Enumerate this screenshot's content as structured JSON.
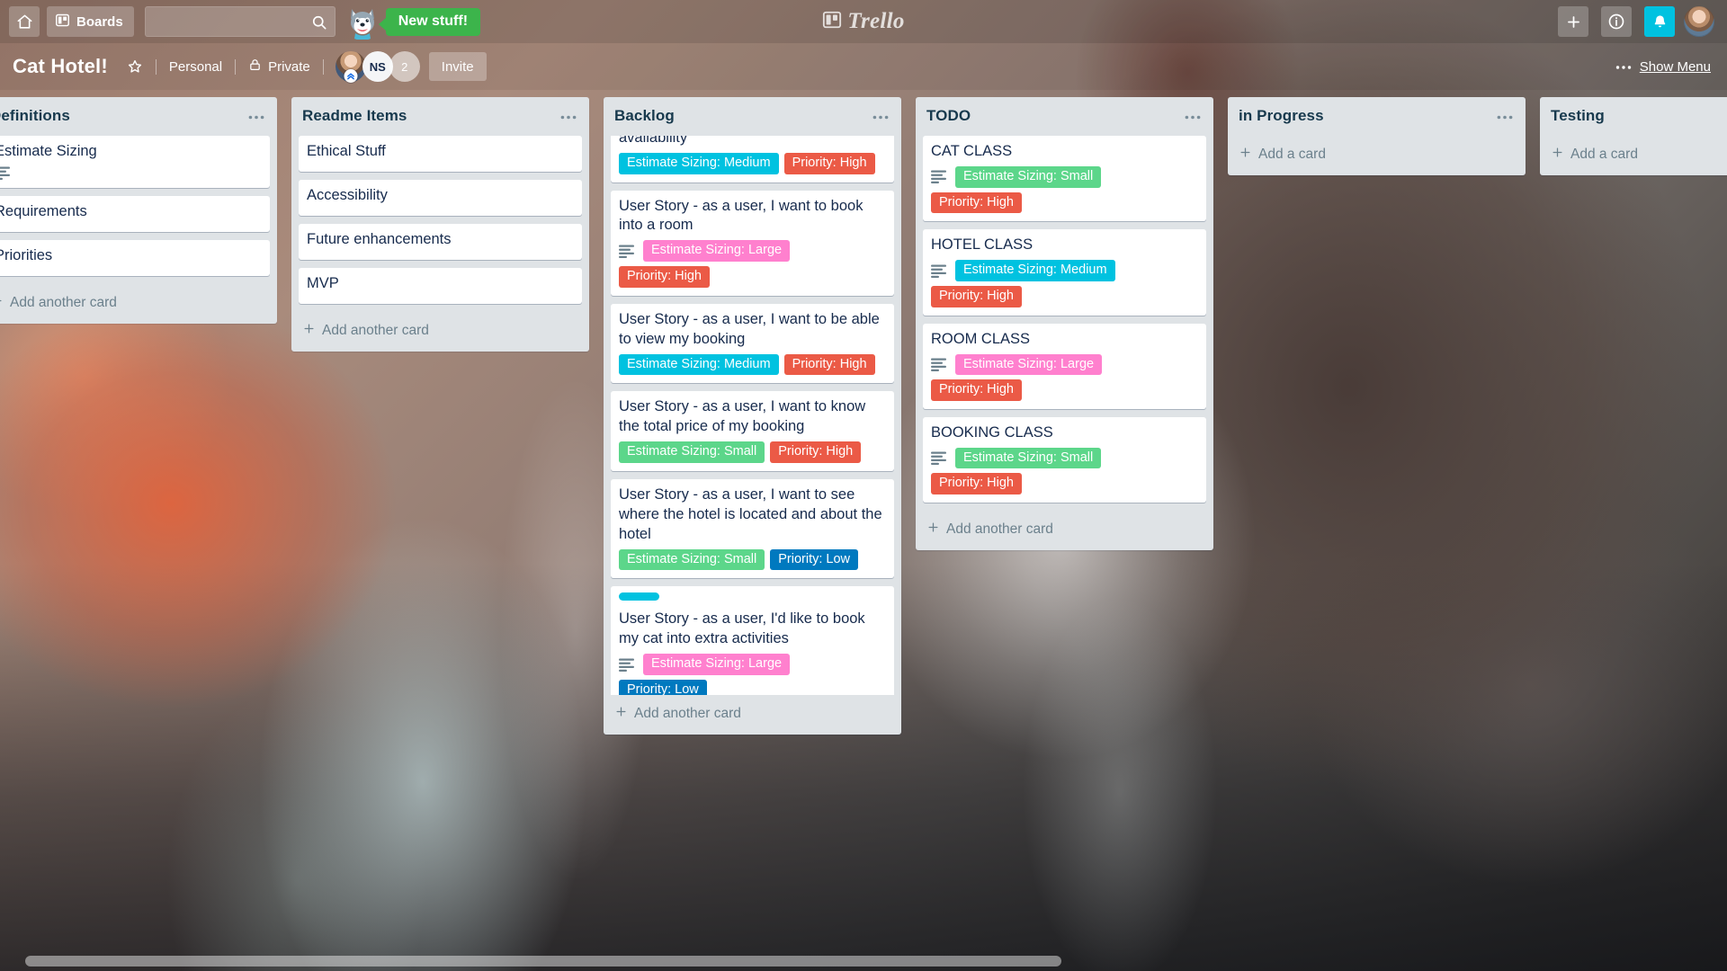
{
  "topnav": {
    "home_icon": "home-icon",
    "boards_label": "Boards",
    "boards_icon": "board-icon",
    "search_placeholder": "",
    "search_value": "",
    "search_icon": "search-icon",
    "mascot_icon": "husky-mascot-icon",
    "new_stuff_label": "New stuff!",
    "logo_text": "Trello",
    "logo_icon": "trello-logo-icon",
    "add_icon": "plus-icon",
    "info_icon": "info-icon",
    "notifications_icon": "bell-icon",
    "notifications_active_color": "#00c2e0",
    "avatar_icon": "user-avatar"
  },
  "boardbar": {
    "title": "Cat Hotel!",
    "star_icon": "star-icon",
    "team_label": "Personal",
    "visibility_label": "Private",
    "visibility_icon": "lock-icon",
    "members": [
      {
        "type": "photo",
        "label": "",
        "name": "member-avatar-photo"
      },
      {
        "type": "initials",
        "label": "NS",
        "name": "member-avatar-ns"
      },
      {
        "type": "count",
        "label": "2",
        "name": "member-overflow-count"
      }
    ],
    "invite_label": "Invite",
    "menu_dots": "•••",
    "show_menu_label": "Show Menu"
  },
  "colors": {
    "label_green": "#61bd4f",
    "label_green_light": "#5cd68a",
    "label_sky": "#00c2e0",
    "label_pink": "#ff80ce",
    "label_red": "#eb5a46",
    "label_blue": "#0079bf",
    "list_bg": "#dfe3e6",
    "card_bg": "#ffffff",
    "text_dark": "#172b4d"
  },
  "lists": [
    {
      "title": "Definitions",
      "clipped_left": true,
      "add_label": "Add another card",
      "cards": [
        {
          "title": "Estimate Sizing",
          "has_description": true,
          "labels": []
        },
        {
          "title": "Requirements",
          "has_description": false,
          "labels": []
        },
        {
          "title": "Priorities",
          "has_description": false,
          "labels": []
        }
      ]
    },
    {
      "title": "Readme Items",
      "add_label": "Add another card",
      "cards": [
        {
          "title": "Ethical Stuff",
          "has_description": false,
          "labels": []
        },
        {
          "title": "Accessibility",
          "has_description": false,
          "labels": []
        },
        {
          "title": "Future enhancements",
          "has_description": false,
          "labels": []
        },
        {
          "title": "MVP",
          "has_description": false,
          "labels": []
        }
      ]
    },
    {
      "title": "Backlog",
      "scrolled": true,
      "add_label": "Add another card",
      "cards": [
        {
          "title": "all the room features, price and availability",
          "clipped_top": true,
          "has_description": false,
          "labels": [
            {
              "text": "Estimate Sizing: Medium",
              "color": "#00c2e0"
            },
            {
              "text": "Priority: High",
              "color": "#eb5a46"
            }
          ]
        },
        {
          "title": "User Story - as a user, I want to book into a room",
          "has_description": true,
          "labels": [
            {
              "text": "Estimate Sizing: Large",
              "color": "#ff80ce"
            },
            {
              "text": "Priority: High",
              "color": "#eb5a46"
            }
          ]
        },
        {
          "title": "User Story - as a user, I want to be able to view my booking",
          "has_description": false,
          "labels": [
            {
              "text": "Estimate Sizing: Medium",
              "color": "#00c2e0"
            },
            {
              "text": "Priority: High",
              "color": "#eb5a46"
            }
          ]
        },
        {
          "title": "User Story - as a user, I want to know the total price of my booking",
          "has_description": false,
          "labels": [
            {
              "text": "Estimate Sizing: Small",
              "color": "#5cd68a"
            },
            {
              "text": "Priority: High",
              "color": "#eb5a46"
            }
          ]
        },
        {
          "title": "User Story - as a user, I want to see where the hotel is located and about the hotel",
          "has_description": false,
          "labels": [
            {
              "text": "Estimate Sizing: Small",
              "color": "#5cd68a"
            },
            {
              "text": "Priority: Low",
              "color": "#0079bf"
            }
          ]
        },
        {
          "title": "User Story - as a user, I'd like to book my cat into extra activities",
          "has_description": true,
          "stripe_color": "#00c2e0",
          "labels": [
            {
              "text": "Estimate Sizing: Large",
              "color": "#ff80ce"
            },
            {
              "text": "Priority: Low",
              "color": "#0079bf"
            }
          ]
        }
      ]
    },
    {
      "title": "TODO",
      "add_label": "Add another card",
      "cards": [
        {
          "title": "CAT CLASS",
          "has_description": true,
          "labels": [
            {
              "text": "Estimate Sizing: Small",
              "color": "#5cd68a"
            },
            {
              "text": "Priority: High",
              "color": "#eb5a46"
            }
          ]
        },
        {
          "title": "HOTEL CLASS",
          "has_description": true,
          "labels": [
            {
              "text": "Estimate Sizing: Medium",
              "color": "#00c2e0"
            },
            {
              "text": "Priority: High",
              "color": "#eb5a46"
            }
          ]
        },
        {
          "title": "ROOM CLASS",
          "has_description": true,
          "labels": [
            {
              "text": "Estimate Sizing: Large",
              "color": "#ff80ce"
            },
            {
              "text": "Priority: High",
              "color": "#eb5a46"
            }
          ]
        },
        {
          "title": "BOOKING CLASS",
          "has_description": true,
          "labels": [
            {
              "text": "Estimate Sizing: Small",
              "color": "#5cd68a"
            },
            {
              "text": "Priority: High",
              "color": "#eb5a46"
            }
          ]
        }
      ]
    },
    {
      "title": "in Progress",
      "add_label": "Add a card",
      "cards": []
    },
    {
      "title": "Testing",
      "add_label": "Add a card",
      "cards": []
    }
  ]
}
